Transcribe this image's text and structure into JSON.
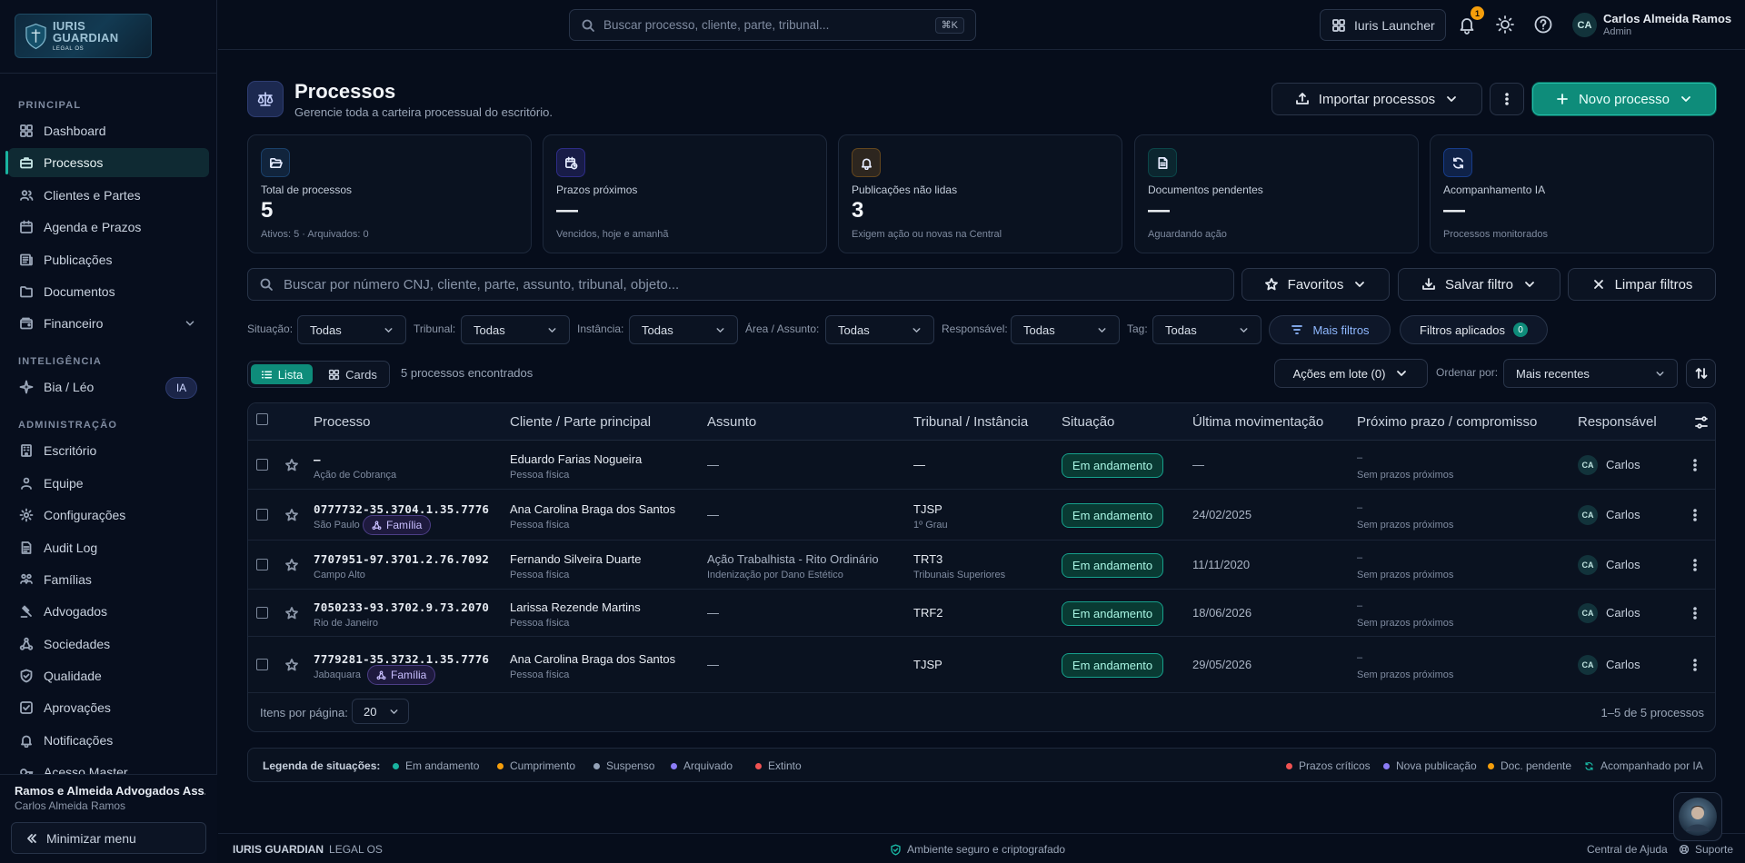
{
  "brand": {
    "name": "IURIS GUARDIAN",
    "tagline": "LEGAL OS"
  },
  "sidebar": {
    "sections": [
      {
        "title": "PRINCIPAL",
        "items": [
          {
            "label": "Dashboard",
            "icon": "dashboard-icon"
          },
          {
            "label": "Processos",
            "icon": "briefcase-icon",
            "active": true
          },
          {
            "label": "Clientes e Partes",
            "icon": "users-icon"
          },
          {
            "label": "Agenda e Prazos",
            "icon": "calendar-icon"
          },
          {
            "label": "Publicações",
            "icon": "newspaper-icon"
          },
          {
            "label": "Documentos",
            "icon": "folder-icon"
          },
          {
            "label": "Financeiro",
            "icon": "wallet-icon",
            "expandable": true
          }
        ]
      },
      {
        "title": "INTELIGÊNCIA",
        "items": [
          {
            "label": "Bia / Léo",
            "icon": "sparkle-icon",
            "badge": "IA"
          }
        ]
      },
      {
        "title": "ADMINISTRAÇÃO",
        "items": [
          {
            "label": "Escritório",
            "icon": "building-icon"
          },
          {
            "label": "Equipe",
            "icon": "team-icon"
          },
          {
            "label": "Configurações",
            "icon": "gear-icon"
          },
          {
            "label": "Audit Log",
            "icon": "log-icon"
          },
          {
            "label": "Famílias",
            "icon": "family-icon"
          },
          {
            "label": "Advogados",
            "icon": "gavel-icon"
          },
          {
            "label": "Sociedades",
            "icon": "network-icon"
          },
          {
            "label": "Qualidade",
            "icon": "shield-check-icon"
          },
          {
            "label": "Aprovações",
            "icon": "approval-icon"
          },
          {
            "label": "Notificações",
            "icon": "bell-icon"
          },
          {
            "label": "Acesso Master",
            "icon": "key-icon"
          }
        ]
      }
    ],
    "footer": {
      "org_name": "Ramos e Almeida Advogados Ass...",
      "org_user": "Carlos Almeida Ramos",
      "minimize_label": "Minimizar menu"
    }
  },
  "topbar": {
    "search_placeholder": "Buscar processo, cliente, parte, tribunal...",
    "shortcut": "⌘K",
    "launcher_label": "Iuris Launcher",
    "notification_count": "1",
    "user_initials": "CA",
    "user_name": "Carlos Almeida Ramos",
    "user_role": "Admin"
  },
  "page": {
    "title": "Processos",
    "subtitle": "Gerencie toda a carteira processual do escritório.",
    "import_label": "Importar processos",
    "new_label": "Novo processo"
  },
  "stats": [
    {
      "label": "Total de processos",
      "value": "5",
      "sub": "Ativos: 5 · Arquivados: 0",
      "icon": "folder-open-icon",
      "color": "#2b6cb0"
    },
    {
      "label": "Prazos próximos",
      "value": "—",
      "sub": "Vencidos, hoje e amanhã",
      "icon": "calendar-clock-icon",
      "color": "#4f46e5"
    },
    {
      "label": "Publicações não lidas",
      "value": "3",
      "sub": "Exigem ação ou novas na Central",
      "icon": "bell-icon",
      "color": "#b7791f"
    },
    {
      "label": "Documentos pendentes",
      "value": "—",
      "sub": "Aguardando ação",
      "icon": "document-icon",
      "color": "#0f766e"
    },
    {
      "label": "Acompanhamento IA",
      "value": "—",
      "sub": "Processos monitorados",
      "icon": "refresh-icon",
      "color": "#2563eb"
    }
  ],
  "search": {
    "placeholder": "Buscar por número CNJ, cliente, parte, assunto, tribunal, objeto...",
    "favoritos_label": "Favoritos",
    "salvar_label": "Salvar filtro",
    "limpar_label": "Limpar filtros"
  },
  "filters": [
    {
      "label": "Situação:",
      "value": "Todas"
    },
    {
      "label": "Tribunal:",
      "value": "Todas"
    },
    {
      "label": "Instância:",
      "value": "Todas"
    },
    {
      "label": "Área / Assunto:",
      "value": "Todas"
    },
    {
      "label": "Responsável:",
      "value": "Todas"
    },
    {
      "label": "Tag:",
      "value": "Todas"
    }
  ],
  "filter_chips": {
    "more_label": "Mais filtros",
    "applied_label": "Filtros aplicados",
    "applied_count": "0"
  },
  "view": {
    "list_label": "Lista",
    "cards_label": "Cards",
    "count_text": "5 processos encontrados",
    "batch_label": "Ações em lote (0)",
    "order_label": "Ordenar por:",
    "order_value": "Mais recentes"
  },
  "table": {
    "headers": [
      "Processo",
      "Cliente / Parte principal",
      "Assunto",
      "Tribunal / Instância",
      "Situação",
      "Última movimentação",
      "Próximo prazo / compromisso",
      "Responsável"
    ],
    "rows": [
      {
        "numero": "—",
        "local": "Ação de Cobrança",
        "tag": "",
        "cliente": "Eduardo Farias Nogueira",
        "tipo": "Pessoa física",
        "assunto": "—",
        "assunto_sub": "",
        "tribunal": "—",
        "instancia": "",
        "situacao": "Em andamento",
        "ultima": "—",
        "prazo": "–",
        "prazo_sub": "Sem prazos próximos",
        "resp_initials": "CA",
        "resp": "Carlos"
      },
      {
        "numero": "0777732-35.3704.1.35.7776",
        "local": "São Paulo",
        "tag": "Família",
        "cliente": "Ana Carolina Braga dos Santos",
        "tipo": "Pessoa física",
        "assunto": "—",
        "assunto_sub": "",
        "tribunal": "TJSP",
        "instancia": "1º Grau",
        "situacao": "Em andamento",
        "ultima": "24/02/2025",
        "prazo": "–",
        "prazo_sub": "Sem prazos próximos",
        "resp_initials": "CA",
        "resp": "Carlos"
      },
      {
        "numero": "7707951-97.3701.2.76.7092",
        "local": "Campo Alto",
        "tag": "",
        "cliente": "Fernando Silveira Duarte",
        "tipo": "Pessoa física",
        "assunto": "Ação Trabalhista - Rito Ordinário",
        "assunto_sub": "Indenização por Dano Estético",
        "tribunal": "TRT3",
        "instancia": "Tribunais Superiores",
        "situacao": "Em andamento",
        "ultima": "11/11/2020",
        "prazo": "–",
        "prazo_sub": "Sem prazos próximos",
        "resp_initials": "CA",
        "resp": "Carlos"
      },
      {
        "numero": "7050233-93.3702.9.73.2070",
        "local": "Rio de Janeiro",
        "tag": "",
        "cliente": "Larissa Rezende Martins",
        "tipo": "Pessoa física",
        "assunto": "—",
        "assunto_sub": "",
        "tribunal": "TRF2",
        "instancia": "",
        "situacao": "Em andamento",
        "ultima": "18/06/2026",
        "prazo": "–",
        "prazo_sub": "Sem prazos próximos",
        "resp_initials": "CA",
        "resp": "Carlos"
      },
      {
        "numero": "7779281-35.3732.1.35.7776",
        "local": "Jabaquara",
        "tag": "Família",
        "cliente": "Ana Carolina Braga dos Santos",
        "tipo": "Pessoa física",
        "assunto": "—",
        "assunto_sub": "",
        "tribunal": "TJSP",
        "instancia": "",
        "situacao": "Em andamento",
        "ultima": "29/05/2026",
        "prazo": "–",
        "prazo_sub": "Sem prazos próximos",
        "resp_initials": "CA",
        "resp": "Carlos"
      }
    ],
    "per_page_label": "Itens por página:",
    "per_page_value": "20",
    "range_text": "1–5 de 5 processos"
  },
  "legend": {
    "title": "Legenda de situações:",
    "status": [
      {
        "label": "Em andamento",
        "color": "#19b3a0"
      },
      {
        "label": "Cumprimento",
        "color": "#f59e0b"
      },
      {
        "label": "Suspenso",
        "color": "#94a3b8"
      },
      {
        "label": "Arquivado",
        "color": "#8b7cf6"
      },
      {
        "label": "Extinto",
        "color": "#f05252"
      }
    ],
    "markers": [
      {
        "label": "Prazos críticos",
        "color": "#f05252"
      },
      {
        "label": "Nova publicação",
        "color": "#8b7cf6"
      },
      {
        "label": "Doc. pendente",
        "color": "#f59e0b"
      },
      {
        "label": "Acompanhado por IA",
        "color": "#19b3a0"
      }
    ]
  },
  "bottom": {
    "brand_strong": "IURIS GUARDIAN",
    "brand_light": "LEGAL OS",
    "secure": "Ambiente seguro e criptografado",
    "help": "Central de Ajuda",
    "support": "Suporte"
  }
}
